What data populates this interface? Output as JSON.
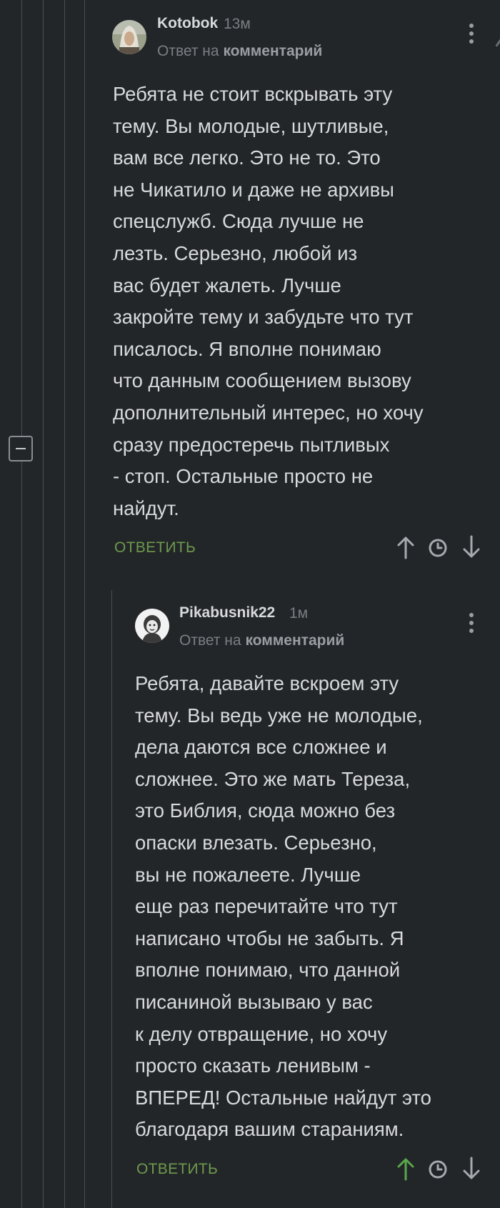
{
  "colors": {
    "background": "#232629",
    "text": "#d7d9dc",
    "muted": "#7a7e82",
    "reply_green": "#6d9a4c",
    "upvoted_green": "#5aa84a"
  },
  "comments": [
    {
      "username": "Kotobok",
      "time": "13м",
      "reply_prefix": "Ответ на",
      "reply_link": "комментарий",
      "lines": [
        "Ребята не стоит вскрывать эту",
        "тему. Вы молодые, шутливые,",
        "вам все легко. Это не то. Это",
        "не Чикатило и даже не архивы",
        "спецслужб. Сюда лучше не",
        "лезть. Серьезно, любой из",
        "вас будет жалеть. Лучше",
        "закройте тему и забудьте что тут",
        "писалось. Я вполне понимаю",
        "что данным сообщением вызову",
        "дополнительный интерес, но хочу",
        "сразу предостеречь пытливых",
        "- стоп. Остальные просто не",
        "найдут."
      ],
      "reply_label": "ОТВЕТИТЬ",
      "icons": [
        "upvote-arrow-icon",
        "clock-icon",
        "downvote-arrow-icon"
      ]
    },
    {
      "username": "Pikabusnik22",
      "time": "1м",
      "reply_prefix": "Ответ на",
      "reply_link": "комментарий",
      "lines": [
        "Ребята, давайте вскроем эту",
        "тему. Вы ведь уже не молодые,",
        "дела даются все сложнее и",
        "сложнее. Это же мать Тереза,",
        "это Библия, сюда можно без",
        "опаски влезать. Серьезно,",
        "вы не пожалеете. Лучше",
        "еще раз перечитайте что тут",
        "написано чтобы не забыть. Я",
        "вполне понимаю, что данной",
        "писаниной вызываю у вас",
        "к делу отвращение, но хочу",
        "просто сказать ленивым -",
        "ВПЕРЕД! Остальные найдут это",
        "благодаря вашим стараниям."
      ],
      "reply_label": "ОТВЕТИТЬ",
      "upvoted": true,
      "icons": [
        "upvote-arrow-icon",
        "clock-icon",
        "downvote-arrow-icon"
      ]
    }
  ]
}
